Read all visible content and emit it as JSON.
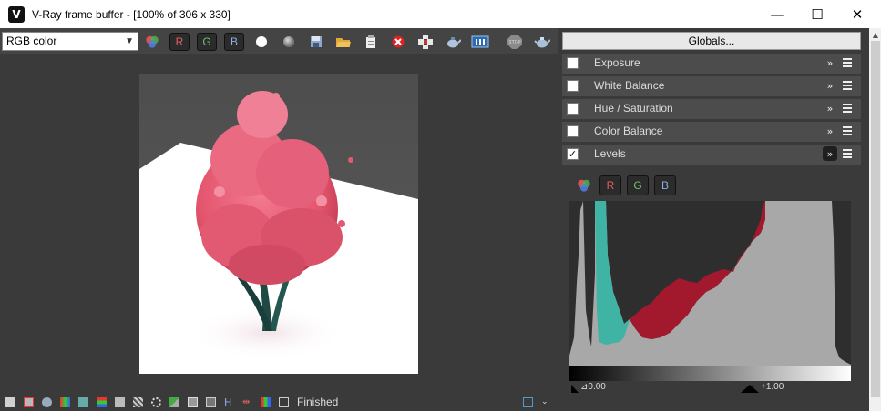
{
  "window": {
    "title": "V-Ray frame buffer - [100% of 306 x 330]",
    "app_icon_glyph": "V",
    "minimize_glyph": "—",
    "maximize_glyph": "☐",
    "close_glyph": "✕"
  },
  "toolbar": {
    "channel_select": "RGB color",
    "channel_buttons": {
      "r": "R",
      "g": "G",
      "b": "B"
    }
  },
  "status": {
    "text": "Finished"
  },
  "panel": {
    "globals_label": "Globals...",
    "rows": [
      {
        "label": "Exposure",
        "checked": false
      },
      {
        "label": "White Balance",
        "checked": false
      },
      {
        "label": "Hue / Saturation",
        "checked": false
      },
      {
        "label": "Color Balance",
        "checked": false
      },
      {
        "label": "Levels",
        "checked": true
      }
    ],
    "levels": {
      "channel_buttons": {
        "r": "R",
        "g": "G",
        "b": "B"
      },
      "input_black": "0.00",
      "input_white": "1.00"
    }
  },
  "colors": {
    "accent_red": "#e06060",
    "accent_green": "#70c070",
    "accent_blue": "#8ab0e0",
    "histogram_teal": "#3fb3a4",
    "histogram_red": "#a2182c",
    "histogram_gray": "#a8a8a8"
  },
  "icons": [
    "app-logo-icon",
    "color-channels-icon",
    "circle-white-icon",
    "circle-gray-icon",
    "save-icon",
    "open-folder-icon",
    "clipboard-icon",
    "clear-icon",
    "region-render-icon",
    "teapot-render-icon",
    "lens-effects-icon",
    "stop-icon",
    "render-teapot-icon"
  ]
}
